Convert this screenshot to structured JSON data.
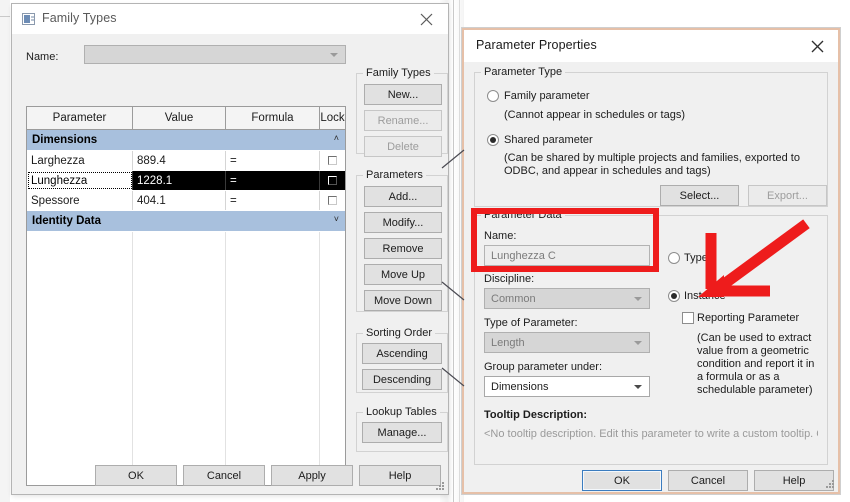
{
  "background": {
    "gap_note": "vertical page-edge hairlines between dialogs"
  },
  "family_types_dialog": {
    "title": "Family Types",
    "icon": "family-types-icon",
    "close_icon": "close-icon",
    "name_label": "Name:",
    "name_value": "",
    "table": {
      "headers": [
        "Parameter",
        "Value",
        "Formula",
        "Lock"
      ],
      "groups": [
        {
          "name": "Dimensions",
          "collapse_glyph": "˄",
          "rows": [
            {
              "parameter": "Larghezza",
              "value": "889.4",
              "formula": "=",
              "lock": false,
              "selected": false
            },
            {
              "parameter": "Lunghezza",
              "value": "1228.1",
              "formula": "=",
              "lock": false,
              "selected": true
            },
            {
              "parameter": "Spessore",
              "value": "404.1",
              "formula": "=",
              "lock": false,
              "selected": false
            }
          ]
        },
        {
          "name": "Identity Data",
          "collapse_glyph": "˅",
          "rows": []
        }
      ]
    },
    "panels": [
      {
        "title": "Family Types",
        "buttons": [
          {
            "label": "New...",
            "enabled": true
          },
          {
            "label": "Rename...",
            "enabled": false
          },
          {
            "label": "Delete",
            "enabled": false
          }
        ]
      },
      {
        "title": "Parameters",
        "buttons": [
          {
            "label": "Add...",
            "enabled": true
          },
          {
            "label": "Modify...",
            "enabled": true
          },
          {
            "label": "Remove",
            "enabled": true
          },
          {
            "label": "Move Up",
            "enabled": true
          },
          {
            "label": "Move Down",
            "enabled": true
          }
        ]
      },
      {
        "title": "Sorting Order",
        "buttons": [
          {
            "label": "Ascending",
            "enabled": true
          },
          {
            "label": "Descending",
            "enabled": true
          }
        ]
      },
      {
        "title": "Lookup Tables",
        "buttons": [
          {
            "label": "Manage...",
            "enabled": true
          }
        ]
      }
    ],
    "footer_buttons": [
      {
        "label": "OK"
      },
      {
        "label": "Cancel"
      },
      {
        "label": "Apply"
      },
      {
        "label": "Help"
      }
    ]
  },
  "parameter_properties_dialog": {
    "title": "Parameter Properties",
    "close_icon": "close-icon",
    "parameter_type": {
      "legend": "Parameter Type",
      "options": [
        {
          "label": "Family parameter",
          "selected": false,
          "note": "(Cannot appear in schedules or tags)"
        },
        {
          "label": "Shared parameter",
          "selected": true,
          "note": "(Can be shared by multiple projects and families, exported to ODBC, and appear in schedules and tags)"
        }
      ],
      "select_button": "Select...",
      "export_button": "Export..."
    },
    "parameter_data": {
      "legend": "Parameter Data",
      "name_label": "Name:",
      "name_value": "Lunghezza C",
      "discipline_label": "Discipline:",
      "discipline_value": "Common",
      "type_of_parameter_label": "Type of Parameter:",
      "type_of_parameter_value": "Length",
      "group_parameter_label": "Group parameter under:",
      "group_parameter_value": "Dimensions",
      "tooltip_label": "Tooltip Description:",
      "tooltip_value": "<No tooltip description. Edit this parameter to write a custom tooltip. Custom ...",
      "binding": {
        "type_label": "Type",
        "type_selected": false,
        "instance_label": "Instance",
        "instance_selected": true,
        "reporting_label": "Reporting Parameter",
        "reporting_checked": false,
        "reporting_note": "(Can be used to extract value from a geometric condition and report it in a formula or as a schedulable parameter)"
      }
    },
    "footer_buttons": [
      {
        "label": "OK"
      },
      {
        "label": "Cancel"
      },
      {
        "label": "Help"
      }
    ]
  },
  "annotations": {
    "highlight_color": "#ee1c1c",
    "highlight_rect_target": "parameter-data-name-field",
    "arrow_target": "instance-radio"
  }
}
